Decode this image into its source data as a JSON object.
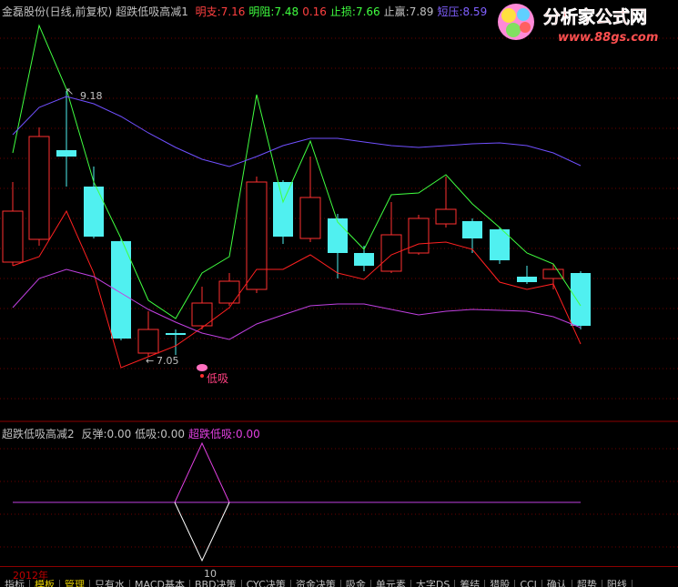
{
  "header1": {
    "stock": "金磊股份(日线,前复权)",
    "indicator": "超跌低吸高减1",
    "items": [
      {
        "label": "明支:",
        "value": "7.16",
        "color": "#ff4040"
      },
      {
        "label": "明阻:",
        "value": "7.48",
        "color": "#40ff40"
      },
      {
        "label": "",
        "value": "0.16",
        "color": "#ff4040"
      },
      {
        "label": "止损:",
        "value": "7.66",
        "color": "#40ff40"
      },
      {
        "label": "止赢:",
        "value": "7.89",
        "color": "#c0c0c0"
      },
      {
        "label": "短压:",
        "value": "8.59",
        "color": "#8060ff"
      }
    ]
  },
  "logo": {
    "text": "分析家公式网",
    "url": "www.88gs.com"
  },
  "annotations": {
    "high": "9.18",
    "low": "7.05",
    "signal": "低吸"
  },
  "header2": {
    "indicator": "超跌低吸高减2",
    "items": [
      {
        "label": "反弹:",
        "value": "0.00",
        "color": "#c0c0c0"
      },
      {
        "label": "低吸:",
        "value": "0.00",
        "color": "#c0c0c0"
      },
      {
        "label": "超跌低吸:",
        "value": "0.00",
        "color": "#e040e0"
      }
    ]
  },
  "timebar": {
    "year": "2012年",
    "month": "10"
  },
  "tabs": [
    "指标",
    "模板",
    "管理",
    "只有水",
    "MACD基本",
    "BBD决策",
    "CYC决策",
    "资金决策",
    "吸金",
    "单元素",
    "大字DS",
    "筹结",
    "猎股",
    "CCI",
    "确认",
    "超势",
    "阳线"
  ],
  "active_tabs": [
    1,
    2
  ],
  "colors": {
    "up": "#ff3030",
    "down": "#50f0f0",
    "green": "#40ff40",
    "purple": "#a070ff",
    "magenta": "#e040e0",
    "grid": "#8b0000"
  }
}
